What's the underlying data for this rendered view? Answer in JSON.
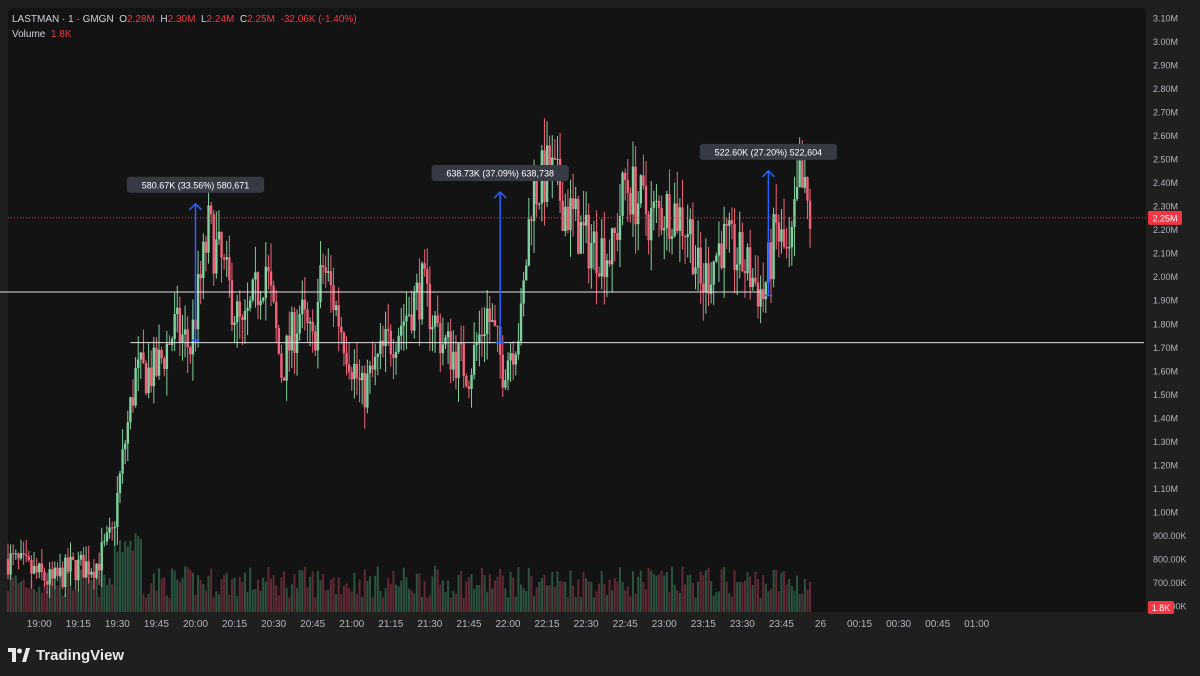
{
  "legend": {
    "symbol": "LASTMAN · 1 · GMGN",
    "o_label": "O",
    "o_value": "2.28M",
    "h_label": "H",
    "h_value": "2.30M",
    "l_label": "L",
    "l_value": "2.24M",
    "c_label": "C",
    "c_value": "2.25M",
    "change": "-32.06K (-1.40%)",
    "volume_label": "Volume",
    "volume_value": "1.8K"
  },
  "brand": {
    "name": "TradingView"
  },
  "colors": {
    "background": "#131313",
    "frame": "#1f1f1f",
    "up": "#7fd1a0",
    "down": "#f2627a",
    "price_tag": "#f23645",
    "measure": "#2962ff",
    "hline": "#e0e0e0",
    "axis_text": "#b2b5be"
  },
  "chart_data": {
    "type": "candlestick",
    "interval": "1 min",
    "y_axis": {
      "min": 0.6,
      "max": 3.1,
      "ticks": [
        "600.00K",
        "700.00K",
        "800.00K",
        "900.00K",
        "1.00M",
        "1.10M",
        "1.20M",
        "1.30M",
        "1.40M",
        "1.50M",
        "1.60M",
        "1.70M",
        "1.80M",
        "1.90M",
        "2.00M",
        "2.10M",
        "2.20M",
        "2.30M",
        "2.40M",
        "2.50M",
        "2.60M",
        "2.70M",
        "2.80M",
        "2.90M",
        "3.00M",
        "3.10M"
      ]
    },
    "x_axis": {
      "ticks": [
        "19:00",
        "19:15",
        "19:30",
        "19:45",
        "20:00",
        "20:15",
        "20:30",
        "20:45",
        "21:00",
        "21:15",
        "21:30",
        "21:45",
        "22:00",
        "22:15",
        "22:30",
        "22:45",
        "23:00",
        "23:15",
        "23:30",
        "23:45",
        "26",
        "00:15",
        "00:30",
        "00:45",
        "01:00"
      ],
      "start_minutes": 1128,
      "end_minutes": 1565
    },
    "last_price": {
      "value": 2.25,
      "label": "2.25M"
    },
    "last_volume": {
      "label": "1.8K"
    },
    "horizontal_lines": [
      {
        "price": 1.72,
        "from": "19:35",
        "to": "end"
      },
      {
        "price": 1.935,
        "from": "23:37",
        "to": "00:35"
      }
    ],
    "measurements": [
      {
        "from_time": "20:00",
        "from_price": 1.73,
        "to_price": 2.31,
        "label": "580.67K (33.56%) 580,671"
      },
      {
        "from_time": "21:57",
        "from_price": 1.72,
        "to_price": 2.36,
        "label": "638.73K (37.09%) 638,738"
      },
      {
        "from_time": "23:40",
        "from_price": 1.92,
        "to_price": 2.45,
        "label": "522.60K (27.20%) 522,604"
      }
    ],
    "close_path": [
      {
        "t": "18:48",
        "p": 0.8
      },
      {
        "t": "19:05",
        "p": 0.7
      },
      {
        "t": "19:12",
        "p": 0.76
      },
      {
        "t": "19:22",
        "p": 0.78
      },
      {
        "t": "19:28",
        "p": 0.9
      },
      {
        "t": "19:33",
        "p": 1.3
      },
      {
        "t": "19:37",
        "p": 1.58
      },
      {
        "t": "19:45",
        "p": 1.6
      },
      {
        "t": "19:52",
        "p": 1.78
      },
      {
        "t": "19:58",
        "p": 1.7
      },
      {
        "t": "20:05",
        "p": 2.2
      },
      {
        "t": "20:10",
        "p": 2.05
      },
      {
        "t": "20:18",
        "p": 1.75
      },
      {
        "t": "20:27",
        "p": 2.05
      },
      {
        "t": "20:33",
        "p": 1.6
      },
      {
        "t": "20:40",
        "p": 1.85
      },
      {
        "t": "20:45",
        "p": 1.7
      },
      {
        "t": "20:49",
        "p": 2.05
      },
      {
        "t": "20:57",
        "p": 1.75
      },
      {
        "t": "21:04",
        "p": 1.5
      },
      {
        "t": "21:13",
        "p": 1.7
      },
      {
        "t": "21:27",
        "p": 1.95
      },
      {
        "t": "21:35",
        "p": 1.72
      },
      {
        "t": "21:45",
        "p": 1.6
      },
      {
        "t": "21:52",
        "p": 1.85
      },
      {
        "t": "21:58",
        "p": 1.62
      },
      {
        "t": "22:05",
        "p": 1.8
      },
      {
        "t": "22:09",
        "p": 2.35
      },
      {
        "t": "22:16",
        "p": 2.45
      },
      {
        "t": "22:22",
        "p": 2.3
      },
      {
        "t": "22:30",
        "p": 2.15
      },
      {
        "t": "22:40",
        "p": 2.1
      },
      {
        "t": "22:45",
        "p": 2.4
      },
      {
        "t": "22:55",
        "p": 2.25
      },
      {
        "t": "23:03",
        "p": 2.3
      },
      {
        "t": "23:10",
        "p": 2.2
      },
      {
        "t": "23:14",
        "p": 1.95
      },
      {
        "t": "23:22",
        "p": 2.15
      },
      {
        "t": "23:31",
        "p": 2.05
      },
      {
        "t": "23:38",
        "p": 1.92
      },
      {
        "t": "23:43",
        "p": 2.2
      },
      {
        "t": "23:48",
        "p": 2.05
      },
      {
        "t": "23:52",
        "p": 2.4
      },
      {
        "t": "23:56",
        "p": 2.25
      }
    ]
  }
}
